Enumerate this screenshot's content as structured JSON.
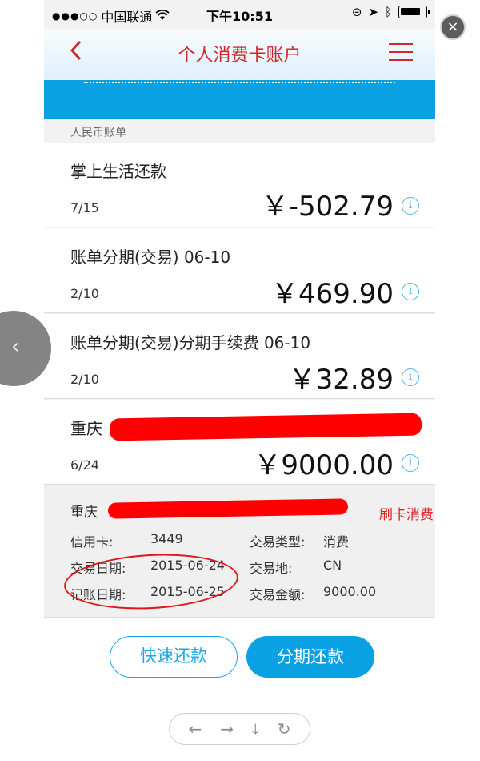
{
  "status_bar": {
    "signal": "●●●○○",
    "carrier": "中国联通",
    "wifi": "wifi-icon",
    "time": "下午10:51",
    "icons": [
      "orientation-lock-icon",
      "location-icon",
      "bluetooth-icon",
      "battery-icon"
    ]
  },
  "nav": {
    "back_icon": "‹",
    "title": "个人消费卡账户",
    "menu_icon": "menu-icon"
  },
  "section": {
    "header": "人民币账单"
  },
  "transactions": [
    {
      "title": "掌上生活还款",
      "date": "7/15",
      "amount": "￥-502.79"
    },
    {
      "title": "账单分期(交易) 06-10",
      "date": "2/10",
      "amount": "￥469.90"
    },
    {
      "title": "账单分期(交易)分期手续费 06-10",
      "date": "2/10",
      "amount": "￥32.89"
    },
    {
      "title": "重庆",
      "date": "6/24",
      "amount": "￥9000.00"
    }
  ],
  "detail": {
    "merchant": "重庆",
    "card_label": "信用卡:",
    "card_value": "3449",
    "trade_date_label": "交易日期:",
    "trade_date_value": "2015-06-24",
    "post_date_label": "记账日期:",
    "post_date_value": "2015-06-25",
    "type_label": "交易类型:",
    "type_value": "消费",
    "place_label": "交易地:",
    "place_value": "CN",
    "amount_label": "交易金额:",
    "amount_value": "9000.00"
  },
  "annotation": {
    "label": "刷卡消费"
  },
  "buttons": {
    "quick_repay": "快速还款",
    "installment_repay": "分期还款"
  },
  "overlay": {
    "close": "×",
    "prev": "‹"
  },
  "toolbar": {
    "back": "←",
    "forward": "→",
    "download": "⤓",
    "refresh": "↻"
  },
  "colors": {
    "brand_red": "#d2272c",
    "accent_blue": "#0aa0e4",
    "annotation_red": "#e02020"
  }
}
